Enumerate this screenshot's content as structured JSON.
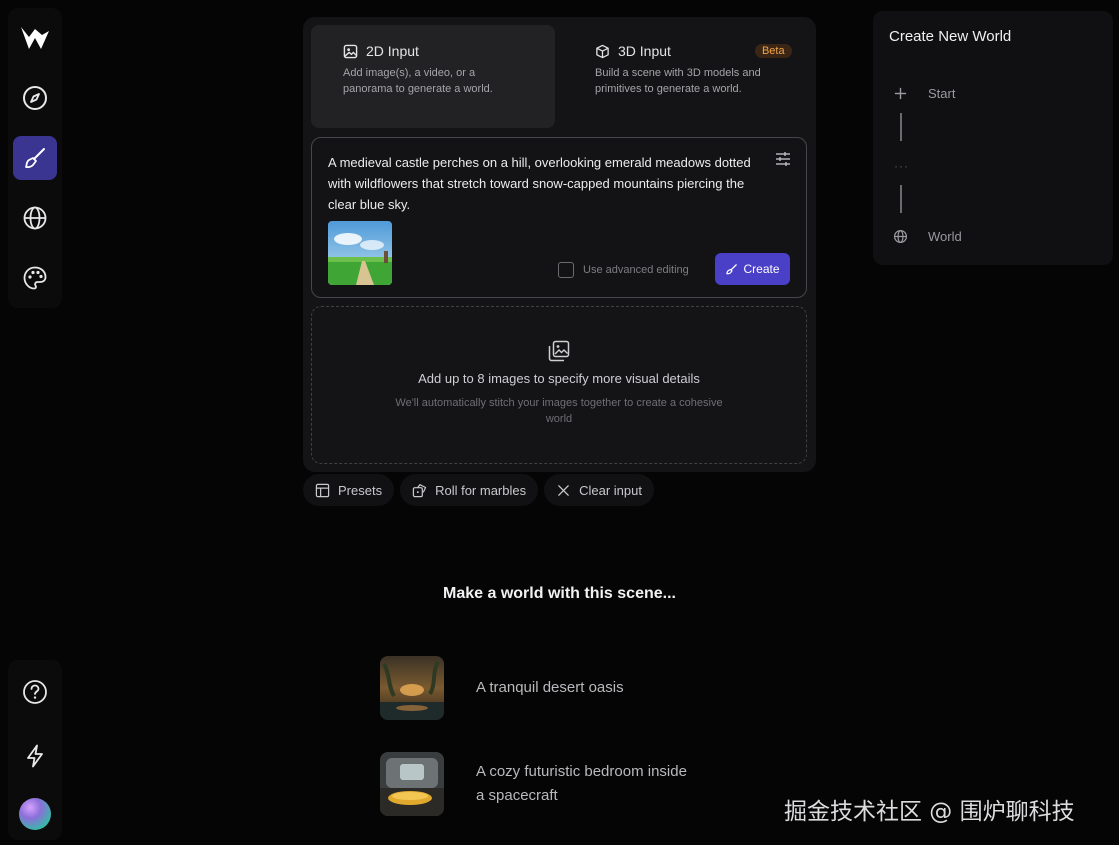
{
  "sidebar": {
    "logo": "brand-logo",
    "items": [
      {
        "name": "explore",
        "icon": "compass-icon"
      },
      {
        "name": "create",
        "icon": "brush-icon",
        "active": true
      },
      {
        "name": "worlds",
        "icon": "globe-icon"
      },
      {
        "name": "styles",
        "icon": "palette-icon"
      }
    ],
    "bottom_items": [
      {
        "name": "help",
        "icon": "help-icon"
      },
      {
        "name": "upgrade",
        "icon": "lightning-icon"
      },
      {
        "name": "profile",
        "icon": "avatar"
      }
    ]
  },
  "modes": {
    "input_2d": {
      "label": "2D Input",
      "description": "Add image(s), a video, or a panorama to generate a world."
    },
    "input_3d": {
      "label": "3D Input",
      "badge": "Beta",
      "description": "Build a scene with 3D models and primitives to generate a world."
    }
  },
  "prompt": {
    "text": "A medieval castle perches on a hill, overlooking emerald meadows dotted with wildflowers that stretch toward snow-capped mountains piercing the clear blue sky.",
    "advanced_editing_label": "Use advanced editing",
    "advanced_editing_checked": false,
    "create_label": "Create"
  },
  "dropzone": {
    "title": "Add up to 8 images to specify more visual details",
    "subtitle": "We'll automatically stitch your images together to create a cohesive world"
  },
  "actions": {
    "presets": "Presets",
    "roll": "Roll for marbles",
    "clear": "Clear input"
  },
  "scenes": {
    "heading": "Make a world with this scene...",
    "items": [
      {
        "label": "A tranquil desert oasis"
      },
      {
        "label": "A cozy futuristic bedroom inside a spacecraft"
      }
    ]
  },
  "panel": {
    "title": "Create New World",
    "steps": {
      "start": "Start",
      "ellipsis": "···",
      "world": "World"
    }
  },
  "watermark": "掘金技术社区 @ 围炉聊科技",
  "colors": {
    "accent": "#4a3fc7",
    "active_nav": "#3a3590",
    "beta_badge": "#f0a44a",
    "background": "#050505"
  }
}
